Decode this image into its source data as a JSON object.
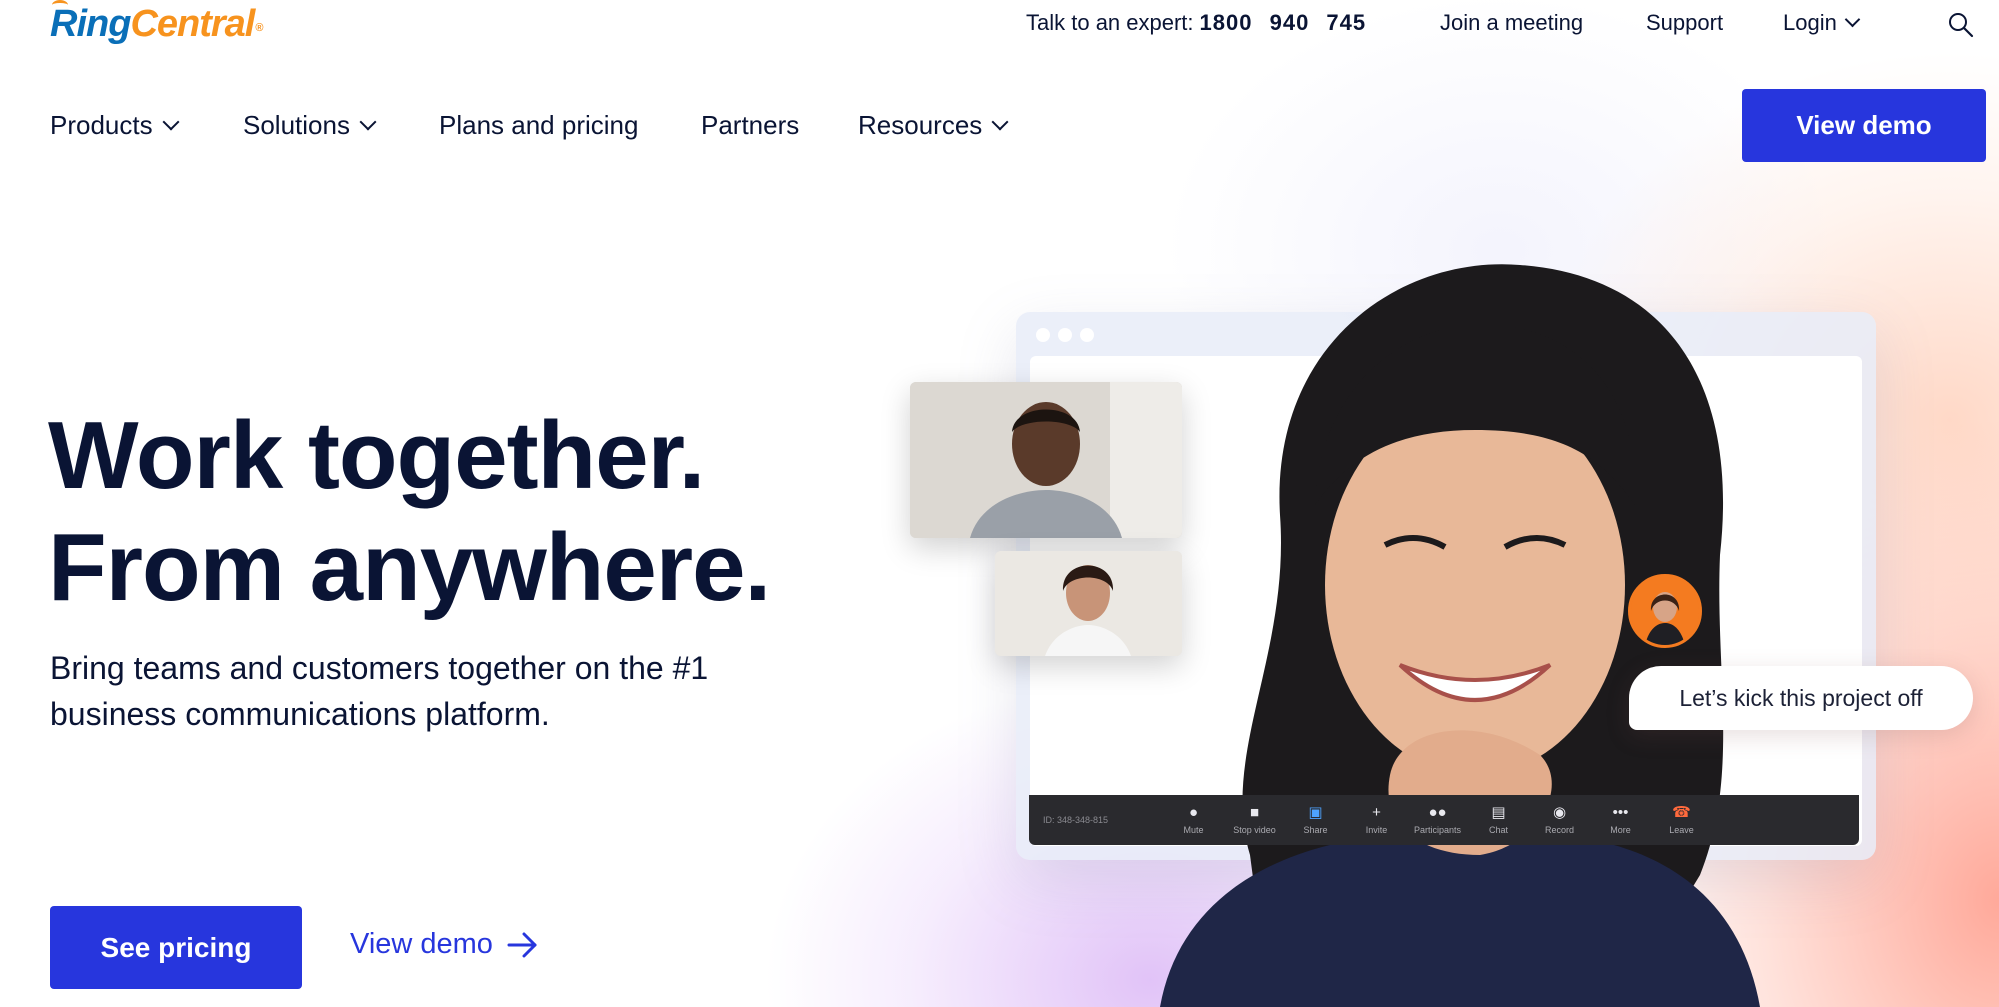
{
  "brand": {
    "logo_part1": "Ring",
    "logo_part2": "Central",
    "logo_reg": "®",
    "primary_color": "#2736dd",
    "dark_text": "#0a1434",
    "logo_blue": "#0a6fb8",
    "logo_orange": "#f7931e"
  },
  "utility_nav": {
    "expert_label": "Talk to an expert:",
    "expert_phone": "1800 940 745",
    "join_meeting": "Join a meeting",
    "support": "Support",
    "login": "Login",
    "search_icon": "search-icon"
  },
  "main_nav": {
    "items": [
      {
        "label": "Products",
        "has_dropdown": true
      },
      {
        "label": "Solutions",
        "has_dropdown": true
      },
      {
        "label": "Plans and pricing",
        "has_dropdown": false
      },
      {
        "label": "Partners",
        "has_dropdown": false
      },
      {
        "label": "Resources",
        "has_dropdown": true
      }
    ],
    "cta_label": "View demo"
  },
  "hero": {
    "title_line1": "Work together.",
    "title_line2": "From anywhere.",
    "subtitle": "Bring teams and customers together on the #1 business communications platform.",
    "primary_cta": "See pricing",
    "secondary_cta": "View demo"
  },
  "video_mock": {
    "meeting_id": "ID: 348-348-815",
    "toolbar": [
      {
        "label": "Mute",
        "icon": "microphone-icon"
      },
      {
        "label": "Stop video",
        "icon": "video-camera-icon"
      },
      {
        "label": "Share",
        "icon": "share-screen-icon"
      },
      {
        "label": "Invite",
        "icon": "invite-user-icon"
      },
      {
        "label": "Participants",
        "icon": "participants-icon"
      },
      {
        "label": "Chat",
        "icon": "chat-icon"
      },
      {
        "label": "Record",
        "icon": "record-icon"
      },
      {
        "label": "More",
        "icon": "more-icon"
      },
      {
        "label": "Leave",
        "icon": "phone-hangup-icon"
      }
    ],
    "chat_message": "Let’s kick this project off"
  }
}
